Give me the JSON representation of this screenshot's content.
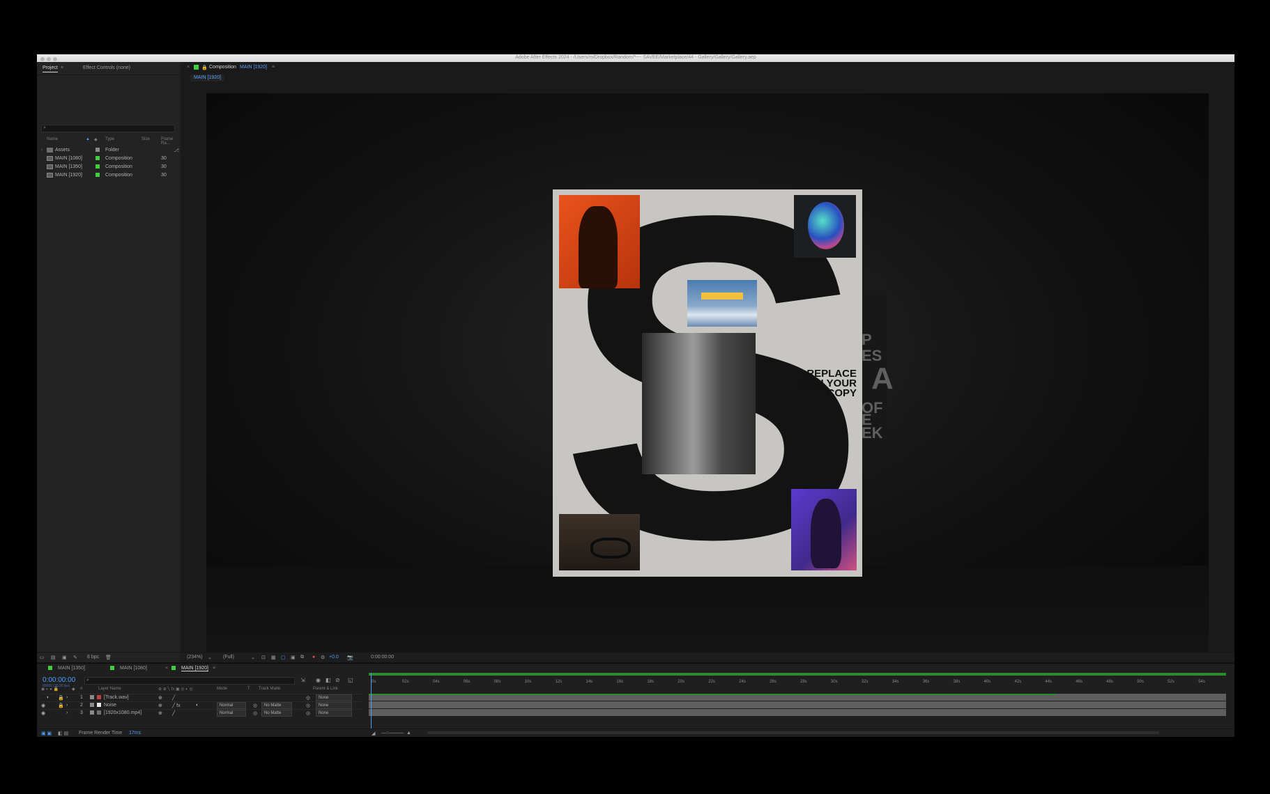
{
  "window": {
    "title": "Adobe After Effects 2024 - /Users/m/Dropbox/Random/*~~ SAVEE/Marketplace/44 - Gallery/Gallery/Gallery.aep"
  },
  "project_panel": {
    "tabs": [
      "Project",
      "Effect Controls (none)"
    ],
    "columns": [
      "Name",
      "Type",
      "Size",
      "Frame Ra..."
    ],
    "items": [
      {
        "name": "Assets",
        "type": "Folder",
        "size": "",
        "fps": "",
        "color": "#8a8a8a"
      },
      {
        "name": "MAIN [1080]",
        "type": "Composition",
        "size": "",
        "fps": "30",
        "color": "#3fcf3f"
      },
      {
        "name": "MAIN [1350]",
        "type": "Composition",
        "size": "",
        "fps": "30",
        "color": "#3fcf3f"
      },
      {
        "name": "MAIN [1920]",
        "type": "Composition",
        "size": "",
        "fps": "30",
        "color": "#3fcf3f"
      }
    ],
    "bpc": "8 bpc"
  },
  "composition_panel": {
    "tab_label": "Composition",
    "tab_comp": "MAIN [1920]",
    "breadcrumb": "MAIN [1920]",
    "poster_copy": [
      "REPLACE",
      "WITH YOUR",
      "COPY"
    ],
    "back_text": [
      "P",
      "ES",
      "A",
      "OF",
      "E",
      "EK"
    ],
    "zoom": "(234%)",
    "resolution": "(Full)",
    "exposure": "+0.0",
    "timecode": "0:00:00:00"
  },
  "timeline": {
    "tabs": [
      "MAIN [1350]",
      "MAIN [1080]",
      "MAIN [1920]"
    ],
    "current_time": "0:00:00:00",
    "fps_note": "00000 (30.00 fps)",
    "columns": [
      "Layer Name",
      "Mode",
      "T",
      "Track Matte",
      "Parent & Link"
    ],
    "layers": [
      {
        "num": "1",
        "name": "[Track.wav]",
        "mode": "",
        "matte": "",
        "parent": "None"
      },
      {
        "num": "2",
        "name": "Noise",
        "mode": "Normal",
        "matte": "No Matte",
        "parent": "None"
      },
      {
        "num": "3",
        "name": "[1920x1080.mp4]",
        "mode": "Normal",
        "matte": "No Matte",
        "parent": "None"
      }
    ],
    "ruler_ticks": [
      "0s",
      "02s",
      "04s",
      "06s",
      "08s",
      "10s",
      "12s",
      "14s",
      "16s",
      "18s",
      "20s",
      "22s",
      "24s",
      "26s",
      "28s",
      "30s",
      "32s",
      "34s",
      "36s",
      "38s",
      "40s",
      "42s",
      "44s",
      "46s",
      "48s",
      "50s",
      "52s",
      "54s"
    ],
    "render_label": "Frame Render Time",
    "render_value": "17ms"
  },
  "colors": {
    "accent": "#4d9cff",
    "comp_label": "#3fcf3f",
    "work_area": "#2c8c2c"
  }
}
